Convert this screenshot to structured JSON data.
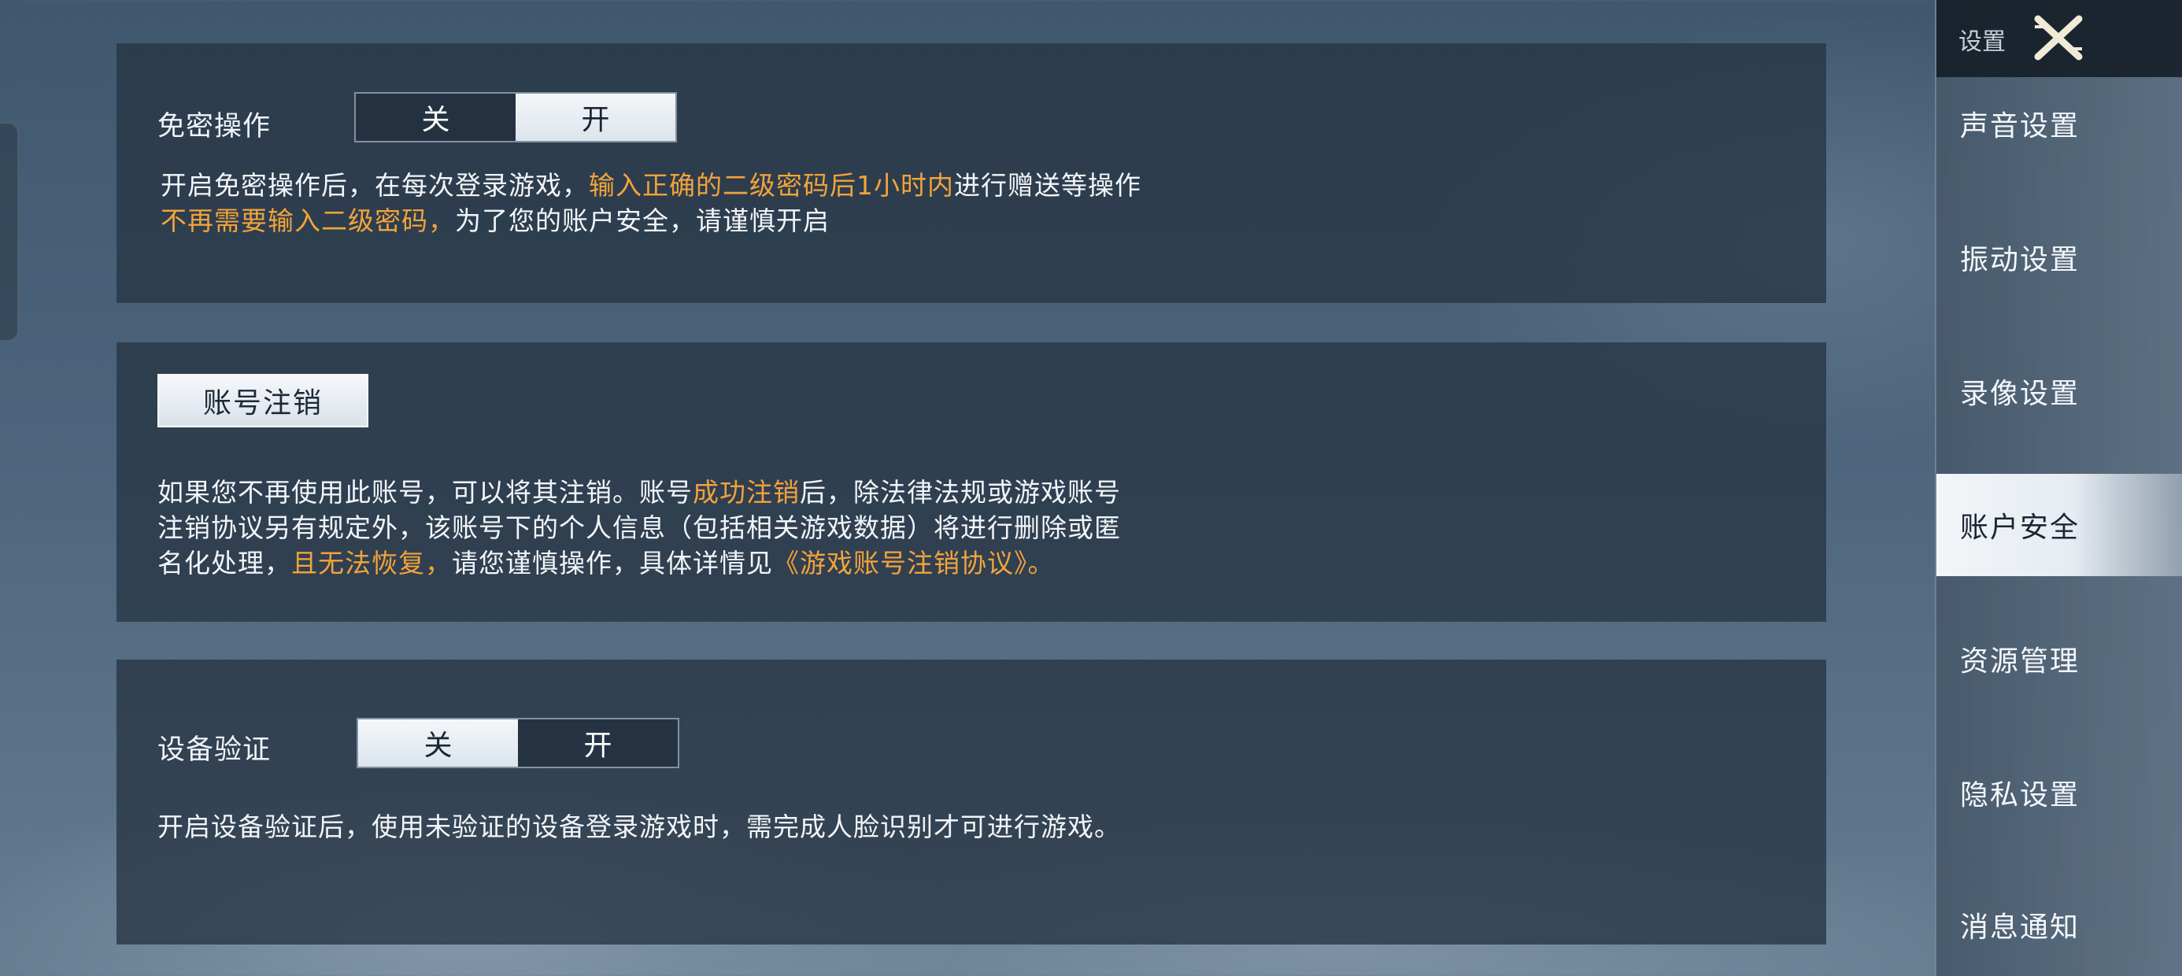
{
  "sections": {
    "passwordless": {
      "label": "免密操作",
      "toggle": {
        "off_label": "关",
        "on_label": "开",
        "selected": "开"
      },
      "desc": {
        "l1_a": "开启免密操作后，在每次登录游戏，",
        "l1_b": "输入正确的二级密码后1小时内",
        "l1_c": "进行赠送等操作",
        "l2_a": "不再需要输入二级密码，",
        "l2_b": "为了您的账户安全，请谨慎开启"
      }
    },
    "deactivation": {
      "button_label": "账号注销",
      "desc": {
        "l1_a": "如果您不再使用此账号，可以将其注销。账号",
        "l1_b": "成功注销",
        "l1_c": "后，除法律法规或游戏账号",
        "l2": "注销协议另有规定外，该账号下的个人信息（包括相关游戏数据）将进行删除或匿",
        "l3_a": "名化处理，",
        "l3_b": "且无法恢复，",
        "l3_c": "请您谨慎操作，具体详情见",
        "l3_link": "《游戏账号注销协议》。"
      }
    },
    "device_verify": {
      "label": "设备验证",
      "toggle": {
        "off_label": "关",
        "on_label": "开",
        "selected": "关"
      },
      "desc": "开启设备验证后，使用未验证的设备登录游戏时，需完成人脸识别才可进行游戏。"
    }
  },
  "sidebar": {
    "title": "设置",
    "close_icon": "close-x-icon",
    "items": [
      {
        "label": "声音设置",
        "active": false
      },
      {
        "label": "振动设置",
        "active": false
      },
      {
        "label": "录像设置",
        "active": false
      },
      {
        "label": "账户安全",
        "active": true
      },
      {
        "label": "资源管理",
        "active": false
      },
      {
        "label": "隐私设置",
        "active": false
      },
      {
        "label": "消息通知",
        "active": false
      }
    ]
  },
  "colors": {
    "highlight": "#f3a33a",
    "panel": "#263444",
    "active_tab": "#f2f5f8"
  }
}
